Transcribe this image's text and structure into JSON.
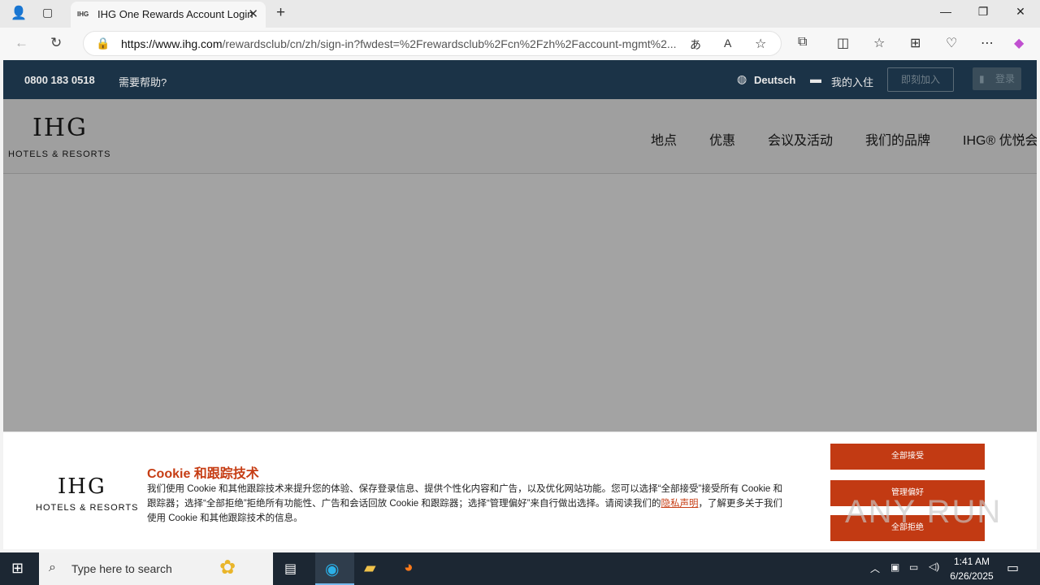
{
  "browser": {
    "tab_title": "IHG One Rewards Account Login",
    "tab_favicon": "IHG",
    "url_host": "https://www.ihg.com",
    "url_path": "/rewardsclub/cn/zh/sign-in?fwdest=%2Frewardsclub%2Fcn%2Fzh%2Faccount-mgmt%2..."
  },
  "topbar": {
    "phone": "0800 183 0518",
    "help": "需要帮助?",
    "language": "Deutsch",
    "my_stays": "我的入住",
    "join": "即刻加入",
    "login": "登录"
  },
  "logo": {
    "wordmark": "IHG",
    "subtitle": "HOTELS & RESORTS"
  },
  "nav": {
    "items": [
      "地点",
      "优惠",
      "会议及活动",
      "我们的品牌",
      "IHG® 优悦会"
    ]
  },
  "cookie": {
    "title": "Cookie 和跟踪技术",
    "text": "我们使用 Cookie 和其他跟踪技术来提升您的体验、保存登录信息、提供个性化内容和广告，以及优化网站功能。您可以选择“全部接受”接受所有 Cookie 和跟踪器；选择“全部拒绝”拒绝所有功能性、广告和会话回放 Cookie 和跟踪器；选择“管理偏好”来自行做出选择。请阅读我们的",
    "link": "隐私声明",
    "text_after": "，了解更多关于我们使用 Cookie 和其他跟踪技术的信息。",
    "accept_all": "全部接受",
    "manage": "管理偏好",
    "reject_all": "全部拒绝"
  },
  "watermark": "ANY RUN",
  "taskbar": {
    "search_placeholder": "Type here to search",
    "time": "1:41 AM",
    "date": "6/26/2025"
  },
  "colors": {
    "accent": "#c23a13",
    "topbar": "#1b3347",
    "overlay": "#a3a3a3"
  }
}
